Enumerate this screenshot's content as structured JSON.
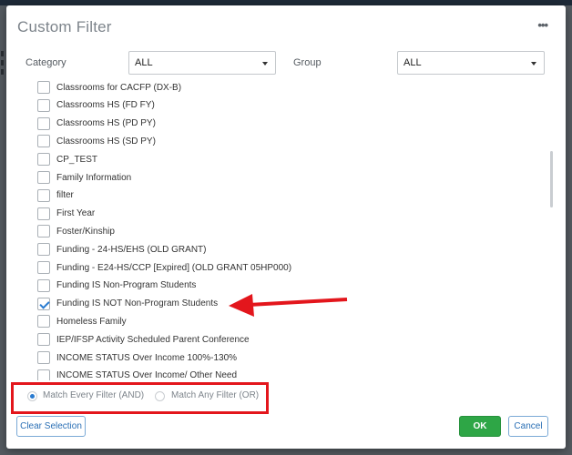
{
  "dialog": {
    "title": "Custom Filter",
    "more_icon_text": "•••"
  },
  "filters": {
    "category_label": "Category",
    "category_value": "ALL",
    "group_label": "Group",
    "group_value": "ALL"
  },
  "items": [
    {
      "label": "Classrooms for CACFP (DX-B)",
      "checked": false
    },
    {
      "label": "Classrooms HS (FD FY)",
      "checked": false
    },
    {
      "label": "Classrooms HS (PD PY)",
      "checked": false
    },
    {
      "label": "Classrooms HS (SD PY)",
      "checked": false
    },
    {
      "label": "CP_TEST",
      "checked": false
    },
    {
      "label": "Family Information",
      "checked": false
    },
    {
      "label": "filter",
      "checked": false
    },
    {
      "label": "First Year",
      "checked": false
    },
    {
      "label": "Foster/Kinship",
      "checked": false
    },
    {
      "label": "Funding - 24-HS/EHS (OLD GRANT)",
      "checked": false
    },
    {
      "label": "Funding - E24-HS/CCP [Expired] (OLD GRANT 05HP000)",
      "checked": false
    },
    {
      "label": "Funding IS Non-Program Students",
      "checked": false
    },
    {
      "label": "Funding IS NOT Non-Program Students",
      "checked": true
    },
    {
      "label": "Homeless Family",
      "checked": false
    },
    {
      "label": "IEP/IFSP Activity Scheduled Parent Conference",
      "checked": false
    },
    {
      "label": "INCOME STATUS Over Income 100%-130%",
      "checked": false
    },
    {
      "label": "INCOME STATUS Over Income/ Other Need",
      "checked": false
    }
  ],
  "match": {
    "every_label": "Match Every Filter (AND)",
    "any_label": "Match Any Filter (OR)",
    "selected": "every"
  },
  "footer": {
    "clear_label": "Clear Selection",
    "ok_label": "OK",
    "cancel_label": "Cancel"
  },
  "colors": {
    "annotation_red": "#e3161c",
    "ok_green": "#2ea646",
    "accent_blue": "#2a7bd0"
  }
}
